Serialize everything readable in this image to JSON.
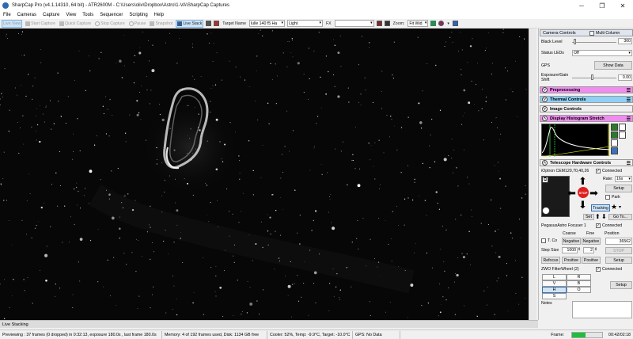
{
  "titlebar": {
    "title": "SharpCap Pro (v4.1.14310, 64 bit) - ATR2600M - C:\\Users\\oliv\\Dropbox\\Astro\\1-VA\\SharpCap Captures",
    "minimize": "─",
    "maximize": "❐",
    "close": "✕"
  },
  "menu": [
    "File",
    "Cameras",
    "Capture",
    "View",
    "Tools",
    "Sequencer",
    "Scripting",
    "Help"
  ],
  "toolbar": {
    "live_view": "Live View",
    "start_capture": "Start Capture",
    "quick_capture": "Quick Capture",
    "stop_capture": "Stop Capture",
    "pause": "Pause",
    "snapshot": "Snapshot",
    "live_stack": "Live Stack",
    "target_name_label": "Target Name",
    "target_name_value": "lulle 140 f5 Ha",
    "frame_type": "Light",
    "fx_label": "FX",
    "fx_value": "",
    "zoom_label": "Zoom:",
    "zoom_value": "Fit Wid"
  },
  "right_panel": {
    "camera_controls": "Camera Controls",
    "multi_column": "Multi Column",
    "black_level_label": "Black Level",
    "black_level_value": "300",
    "status_leds_label": "Status LEDs",
    "status_leds_value": "Off",
    "gps_label": "GPS",
    "show_data": "Show Data",
    "exposure_gain_label": "Exposure/Gain Shift",
    "exposure_gain_value": "0.00",
    "preprocessing": "Preprocessing",
    "thermal_controls": "Thermal Controls",
    "image_controls": "Image Controls",
    "display_histogram": "Display Histogram Stretch",
    "telescope_hw": "Telescope Hardware Controls",
    "mount_name": "iOptron CEM120,70,40,26",
    "connected": "Connected",
    "rate_label": "Rate:",
    "rate_value": "16x",
    "setup": "Setup",
    "park": "Park",
    "stop": "STOP",
    "tracking": "Tracking",
    "set": "Set",
    "goto": "Go To...",
    "focuser_name": "PegasusAstro Focuser 1",
    "coarse": "Coarse",
    "fine": "Fine",
    "position_label": "Position",
    "t_comp": "T. Co",
    "negative": "Negative",
    "position_value": "36562",
    "step_size_label": "Step Size",
    "step_coarse": "1000",
    "step_fine": "2",
    "refocus": "Refocus",
    "positive": "Positive",
    "filterwheel_name": "ZWO FilterWheel (2)",
    "filters": [
      "L",
      "R",
      "V",
      "B",
      "H",
      "O",
      "S"
    ],
    "notes_label": "Notes"
  },
  "bottom_tab": "Live Stacking",
  "status": {
    "previewing": "Previewing : 37 frames (0 dropped) in 0:32:13, exposure 180.0s , last frame 180.0s",
    "memory": "Memory: 4 of 192 frames used, Disk: 1134 GB free",
    "cooler": "Cooler: 52%, Temp: -9.9°C, Target: -10.0°C",
    "gps": "GPS: No Data",
    "frame_label": "Frame:",
    "frame_progress": 0.45,
    "frame_time": "00:42/02:18"
  },
  "colors": {
    "preprocessing": "#f08cf0",
    "thermal": "#8fd0f5",
    "image_controls": "#f0f0f0",
    "histogram": "#f08cf0",
    "telescope": "#f0f0f0",
    "stop_red": "#e02020",
    "progress_green": "#1fbf3a"
  }
}
